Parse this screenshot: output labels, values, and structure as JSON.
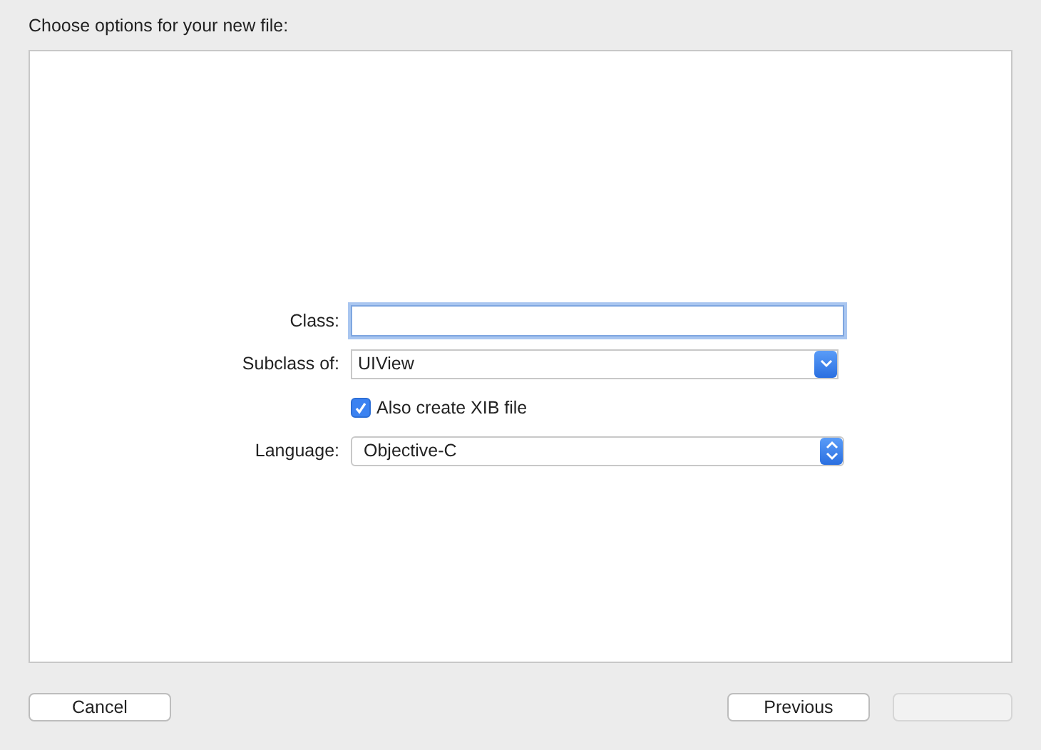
{
  "window": {
    "title": "Choose options for your new file:"
  },
  "form": {
    "class": {
      "label": "Class:",
      "focused": true
    },
    "subclass": {
      "label": "Subclass of:",
      "value": "UIView"
    },
    "xib": {
      "label": "Also create XIB file",
      "checked": true
    },
    "language": {
      "label": "Language:",
      "value": "Objective-C"
    }
  },
  "buttons": [
    {
      "label": "Cancel",
      "disabled": false
    },
    {
      "label": "Previous",
      "disabled": false
    },
    {
      "disabled": true
    }
  ]
}
